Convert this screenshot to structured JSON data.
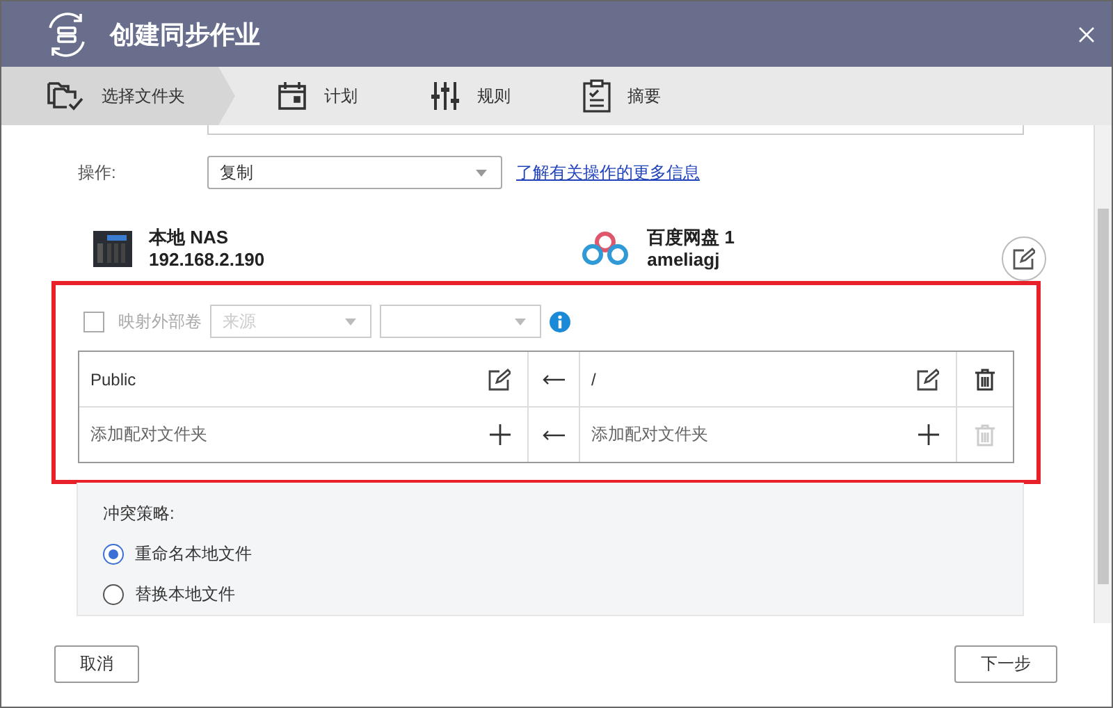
{
  "window": {
    "title": "创建同步作业"
  },
  "steps": [
    {
      "label": "选择文件夹",
      "kind": "folders",
      "selected": true
    },
    {
      "label": "计划",
      "kind": "calendar",
      "selected": false
    },
    {
      "label": "规则",
      "kind": "sliders",
      "selected": false
    },
    {
      "label": "摘要",
      "kind": "clipboard",
      "selected": false
    }
  ],
  "operation": {
    "label": "操作:",
    "value": "复制",
    "link": "了解有关操作的更多信息"
  },
  "local": {
    "name": "本地 NAS",
    "address": "192.168.2.190"
  },
  "remote": {
    "name": "百度网盘 1",
    "account": "ameliagj"
  },
  "mapping": {
    "checkbox_label": "映射外部卷",
    "checked": false,
    "disabled": true,
    "source_placeholder": "来源"
  },
  "folder_pairs": [
    {
      "kind": "pair",
      "local": "Public",
      "remote": "/"
    },
    {
      "kind": "add",
      "local": "添加配对文件夹",
      "remote": "添加配对文件夹"
    }
  ],
  "conflict": {
    "label": "冲突策略:",
    "options": [
      {
        "label": "重命名本地文件",
        "selected": true
      },
      {
        "label": "替换本地文件",
        "selected": false
      }
    ]
  },
  "buttons": {
    "cancel": "取消",
    "next": "下一步"
  }
}
